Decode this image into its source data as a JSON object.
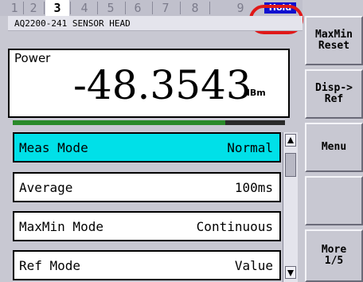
{
  "tabs": [
    "1",
    "2",
    "3",
    "4",
    "5",
    "6",
    "7",
    "8",
    "9"
  ],
  "active_tab": "3",
  "hold_label": "Hold",
  "device_name": "AQ2200-241 SENSOR HEAD",
  "measurement": {
    "label": "Power",
    "value": "-48.3543",
    "unit": "dBm",
    "level_fraction": 0.78
  },
  "settings": [
    {
      "name": "Meas Mode",
      "value": "Normal"
    },
    {
      "name": "Average",
      "value": "100ms"
    },
    {
      "name": "MaxMin Mode",
      "value": "Continuous"
    },
    {
      "name": "Ref Mode",
      "value": "Value"
    }
  ],
  "softkeys": {
    "maxmin_reset": "MaxMin\nReset",
    "disp_ref": "Disp->\nRef",
    "menu": "Menu",
    "blank": "",
    "more": "More\n1/5"
  },
  "colors": {
    "selected_row": "#00e0e8",
    "hold_badge": "#1010d0",
    "highlight_ring": "#e01818",
    "level_fill": "#2a8a2a"
  }
}
